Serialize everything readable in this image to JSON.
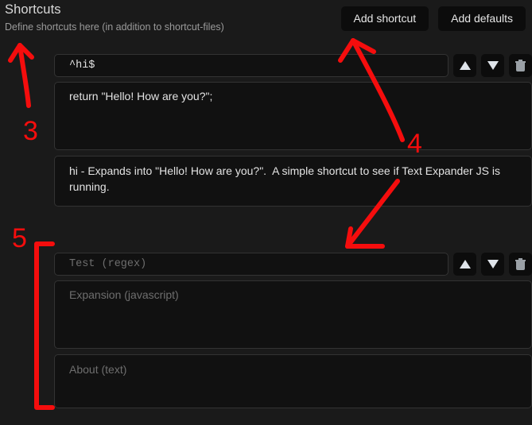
{
  "header": {
    "title": "Shortcuts",
    "subtitle": "Define shortcuts here (in addition to shortcut-files)",
    "add_shortcut_label": "Add shortcut",
    "add_defaults_label": "Add defaults"
  },
  "controls": {
    "move_up_label": "▲",
    "move_down_label": "▼",
    "delete_label": "🗑"
  },
  "placeholders": {
    "test": "Test (regex)",
    "expansion": "Expansion (javascript)",
    "about": "About (text)"
  },
  "shortcuts": [
    {
      "test": "^hi$",
      "expansion": "return \"Hello! How are you?\";",
      "about": "hi - Expands into \"Hello! How are you?\".  A simple shortcut to see if Text Expander JS is running."
    },
    {
      "test": "",
      "expansion": "",
      "about": ""
    }
  ],
  "annotations": {
    "color": "#f50d0d",
    "marks": [
      {
        "label": "3",
        "kind": "arrow-up-to-subtitle"
      },
      {
        "label": "4",
        "kind": "arrows-to-add-shortcut-and-new-row"
      },
      {
        "label": "5",
        "kind": "bracket-around-new-shortcut"
      }
    ]
  }
}
